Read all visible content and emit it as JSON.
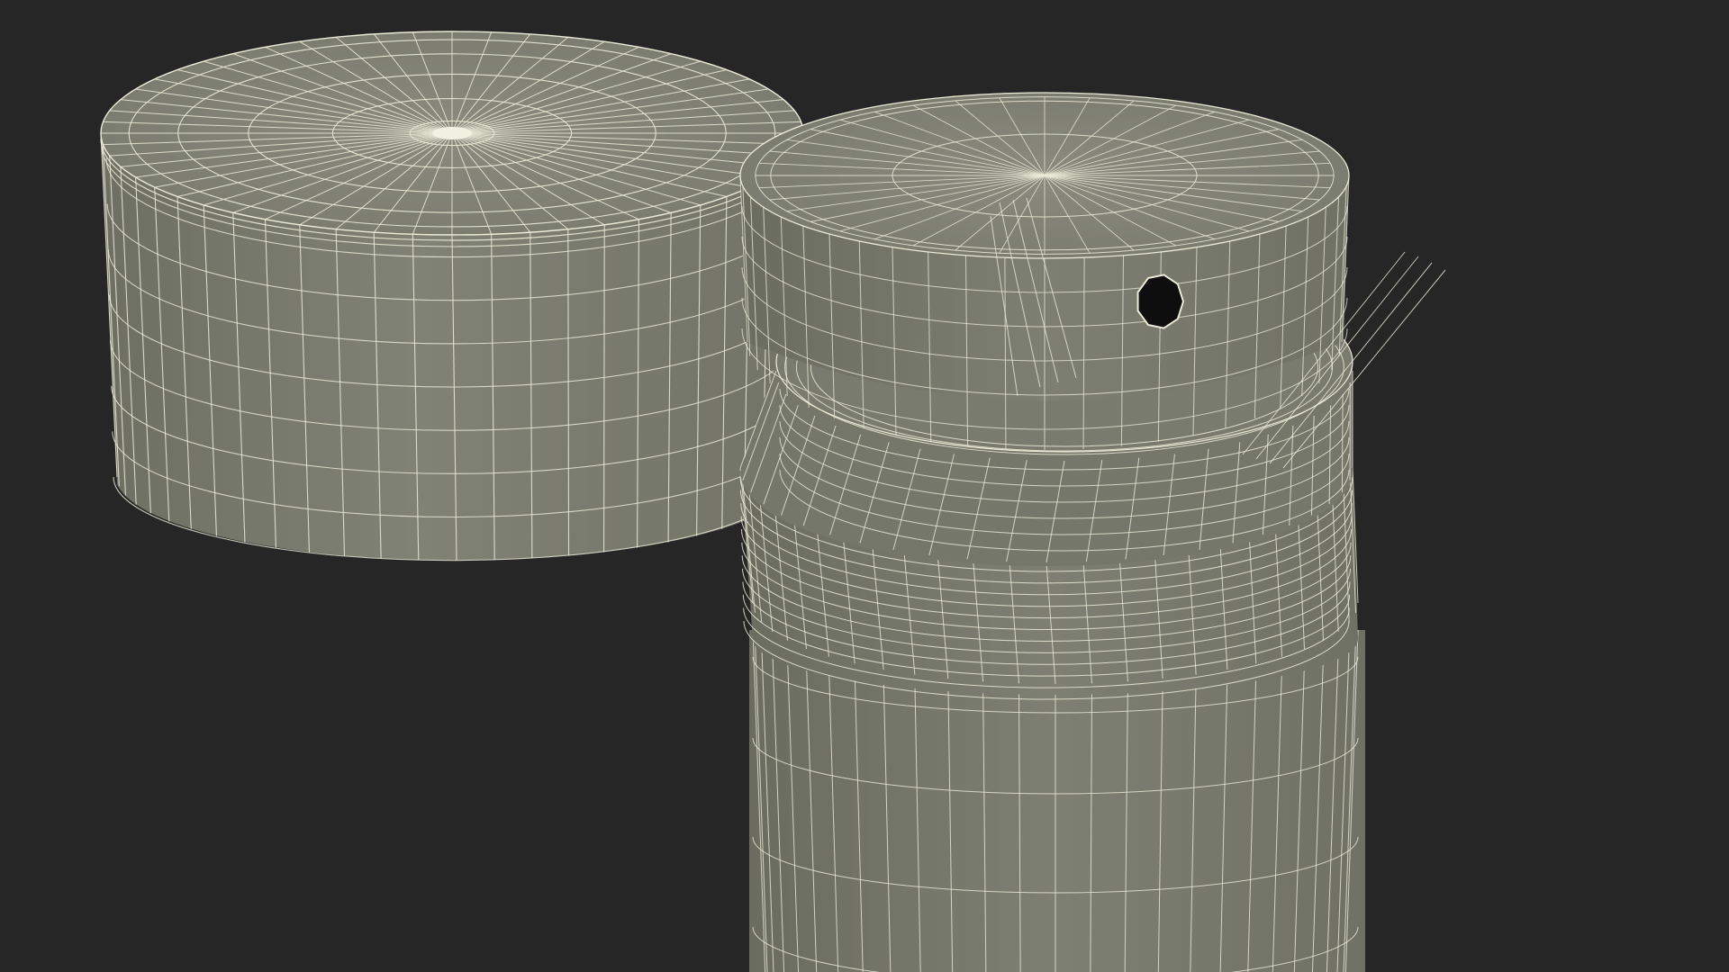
{
  "scene": {
    "background": "#262626",
    "surface_color": "#7c7d70",
    "surface_dark": "#6b6c60",
    "surface_light": "#8a8b7e",
    "wire_color": "#ecebd8",
    "hole_color": "#0e0e0e",
    "objects": [
      {
        "name": "cap",
        "kind": "cylinder-lid"
      },
      {
        "name": "spray-can",
        "kind": "aerosol-can-with-nozzle"
      }
    ]
  }
}
